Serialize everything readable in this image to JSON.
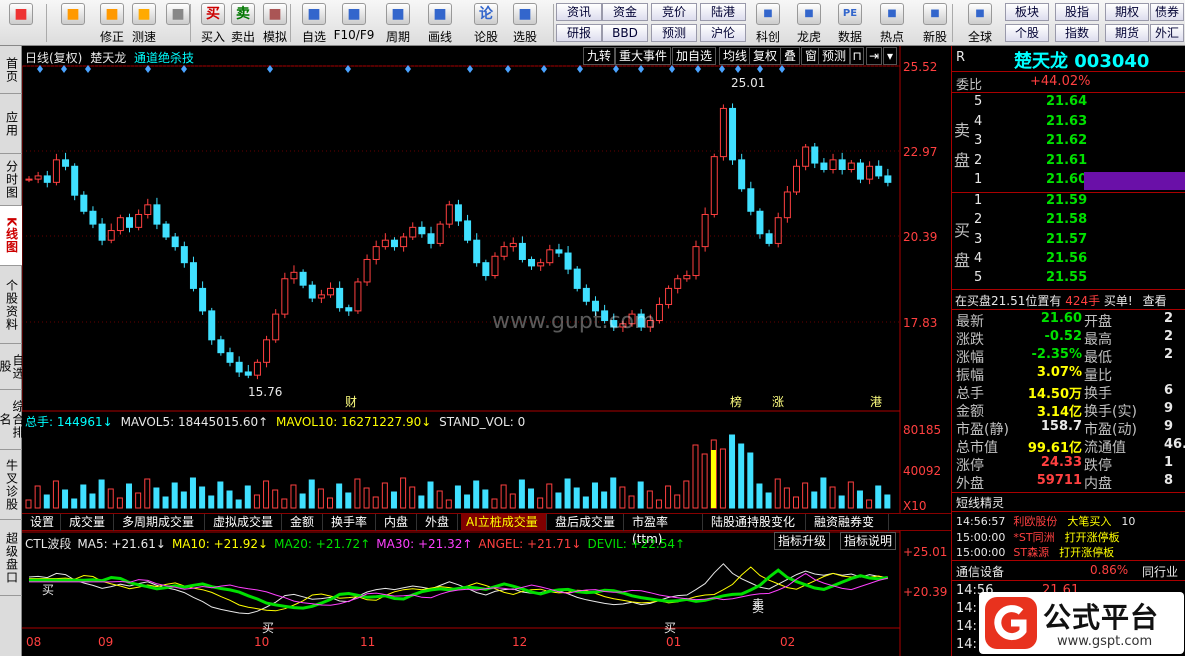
{
  "toolbar": {
    "items": [
      {
        "label": "",
        "icon": "grid-icon"
      },
      {
        "label": "",
        "icon": "back-icon"
      },
      {
        "label": "修正",
        "icon": "up-arrow-icon"
      },
      {
        "label": "测速",
        "icon": "power-icon"
      },
      {
        "label": "",
        "icon": "clock-icon"
      },
      {
        "label": "买入",
        "icon": "buy-icon",
        "glyph": "买"
      },
      {
        "label": "卖出",
        "icon": "sell-icon",
        "glyph": "卖"
      },
      {
        "label": "模拟",
        "icon": "hammer-icon"
      },
      {
        "label": "自选",
        "icon": "star-icon"
      },
      {
        "label": "F10/F9",
        "icon": "f10-icon"
      },
      {
        "label": "周期",
        "icon": "cycle-icon"
      },
      {
        "label": "画线",
        "icon": "pen-icon"
      },
      {
        "label": "论股",
        "icon": "discuss-icon",
        "glyph": "论"
      },
      {
        "label": "选股",
        "icon": "select-stock-icon"
      }
    ],
    "small_buttons": [
      "资讯",
      "资金",
      "竞价",
      "陆港",
      "研报",
      "BBD",
      "预测",
      "沪伦"
    ],
    "right_items": [
      {
        "label": "科创",
        "icon": "kechuang-icon"
      },
      {
        "label": "龙虎",
        "icon": "dragon-icon"
      },
      {
        "label": "数据",
        "icon": "data-icon",
        "glyph": "PE"
      },
      {
        "label": "热点",
        "icon": "hot-icon"
      },
      {
        "label": "新股",
        "icon": "new-stock-icon"
      },
      {
        "label": "全球",
        "icon": "globe-icon"
      }
    ],
    "right_small_buttons": [
      "板块",
      "股指",
      "期权",
      "债券",
      "个股",
      "指数",
      "期货",
      "外汇"
    ]
  },
  "sidebar": {
    "items": [
      "首页",
      "应用",
      "分时图",
      "K线图",
      "个股资料",
      "自选股",
      "综合排名",
      "牛叉诊股",
      "超级盘口"
    ],
    "active_index": 3
  },
  "chart_header": {
    "period": "日线(复权)",
    "stock_name": "楚天龙",
    "indicator": "通道绝杀技",
    "tools": [
      "九转",
      "重大事件",
      "加自选",
      "均线",
      "复权",
      "叠",
      "窗",
      "预测"
    ]
  },
  "price_axis": [
    "25.52",
    "22.97",
    "20.39",
    "17.83"
  ],
  "annotations": {
    "high": "25.01",
    "low": "15.76",
    "events": [
      "财",
      "榜",
      "涨",
      "港"
    ]
  },
  "volume_panel": {
    "legend": {
      "total": "总手: 144961↓",
      "mavol5": "MAVOL5: 18445015.60↑",
      "mavol10": "MAVOL10: 16271227.90↓",
      "stand": "STAND_VOL: 0"
    },
    "axis": [
      "80185",
      "40092",
      "X10"
    ]
  },
  "tabs": [
    "设置",
    "成交量",
    "多周期成交量",
    "虚拟成交量",
    "金额",
    "换手率",
    "内盘",
    "外盘",
    "AI立桩成交量",
    "盘后成交量",
    "市盈率(ttm)",
    "陆股通持股变化",
    "融资融券变化"
  ],
  "active_tab_index": 8,
  "indicator_panel": {
    "legend": [
      {
        "text": "CTL波段",
        "color": "#e8e8e8"
      },
      {
        "text": "MA5: +21.61↓",
        "color": "#e8e8e8"
      },
      {
        "text": "MA10: +21.92↓",
        "color": "#ffff00"
      },
      {
        "text": "MA20: +21.72↑",
        "color": "#00e000"
      },
      {
        "text": "MA30: +21.32↑",
        "color": "#ff40ff"
      },
      {
        "text": "ANGEL: +21.71↓",
        "color": "#ff4040"
      },
      {
        "text": "DEVIL: +22.54↑",
        "color": "#00e000"
      }
    ],
    "buttons": [
      "指标升级",
      "指标说明"
    ],
    "axis": [
      "+25.01",
      "+20.39"
    ],
    "signals": [
      "买",
      "买",
      "买",
      "卖",
      "卖"
    ]
  },
  "x_axis": [
    "08",
    "09",
    "10",
    "11",
    "12",
    "01",
    "02"
  ],
  "quote": {
    "market_code": "R",
    "name": "楚天龙",
    "code": "003040",
    "weibi_label": "委比",
    "weibi_value": "+44.02%",
    "sell_label": "卖盘",
    "buy_label": "买盘",
    "sell": [
      {
        "level": "5",
        "price": "21.64"
      },
      {
        "level": "4",
        "price": "21.63"
      },
      {
        "level": "3",
        "price": "21.62"
      },
      {
        "level": "2",
        "price": "21.61"
      },
      {
        "level": "1",
        "price": "21.60"
      }
    ],
    "buy": [
      {
        "level": "1",
        "price": "21.59"
      },
      {
        "level": "2",
        "price": "21.58"
      },
      {
        "level": "3",
        "price": "21.57"
      },
      {
        "level": "4",
        "price": "21.56"
      },
      {
        "level": "5",
        "price": "21.55"
      }
    ],
    "big_order": {
      "text": "在买盘21.51位置有",
      "qty": "424手",
      "action": "买单!",
      "link": "查看"
    },
    "stats": [
      {
        "l1": "最新",
        "v1": "21.60",
        "c1": "green",
        "l2": "开盘",
        "v2": "2"
      },
      {
        "l1": "涨跌",
        "v1": "-0.52",
        "c1": "green",
        "l2": "最高",
        "v2": "2"
      },
      {
        "l1": "涨幅",
        "v1": "-2.35%",
        "c1": "green",
        "l2": "最低",
        "v2": "2"
      },
      {
        "l1": "振幅",
        "v1": "3.07%",
        "c1": "yellow",
        "l2": "量比",
        "v2": ""
      },
      {
        "l1": "总手",
        "v1": "14.50万",
        "c1": "yellow",
        "l2": "换手",
        "v2": "6"
      },
      {
        "l1": "金额",
        "v1": "3.14亿",
        "c1": "yellow",
        "l2": "换手(实)",
        "v2": "9"
      },
      {
        "l1": "市盈(静)",
        "v1": "158.7",
        "c1": "white",
        "l2": "市盈(动)",
        "v2": "9"
      },
      {
        "l1": "总市值",
        "v1": "99.61亿",
        "c1": "yellow",
        "l2": "流通值",
        "v2": "46."
      },
      {
        "l1": "涨停",
        "v1": "24.33",
        "c1": "red",
        "l2": "跌停",
        "v2": "1"
      },
      {
        "l1": "外盘",
        "v1": "59711",
        "c1": "red",
        "l2": "内盘",
        "v2": "8"
      }
    ],
    "news_title": "短线精灵",
    "news": [
      {
        "time": "14:56:57",
        "name": "利欧股份",
        "event": "大笔买入",
        "extra": "10"
      },
      {
        "time": "15:00:00",
        "name": "*ST同洲",
        "event": "打开涨停板",
        "extra": ""
      },
      {
        "time": "15:00:00",
        "name": "ST森源",
        "event": "打开涨停板",
        "extra": ""
      }
    ],
    "industry": {
      "name": "通信设备",
      "change": "0.86%",
      "link": "同行业"
    },
    "ticks": [
      {
        "time": "14:56",
        "price": "21.61"
      },
      {
        "time": "14:",
        "price": ""
      },
      {
        "time": "14:",
        "price": ""
      },
      {
        "time": "14:",
        "price": ""
      }
    ]
  },
  "watermark": "www.gupt.com",
  "logo": {
    "text": "公式平台",
    "url": "www.gspt.com"
  }
}
